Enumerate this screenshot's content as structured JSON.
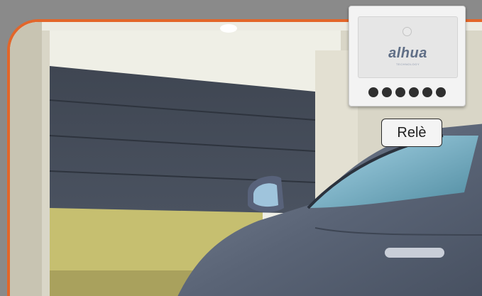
{
  "scene": {
    "description_icon": "garage-with-car-photo",
    "accent_color": "#e2662a"
  },
  "relay": {
    "brand": "alhua",
    "brand_tagline": "TECHNOLOGY",
    "indicator_count": 6
  },
  "label": {
    "text": "Relè"
  }
}
